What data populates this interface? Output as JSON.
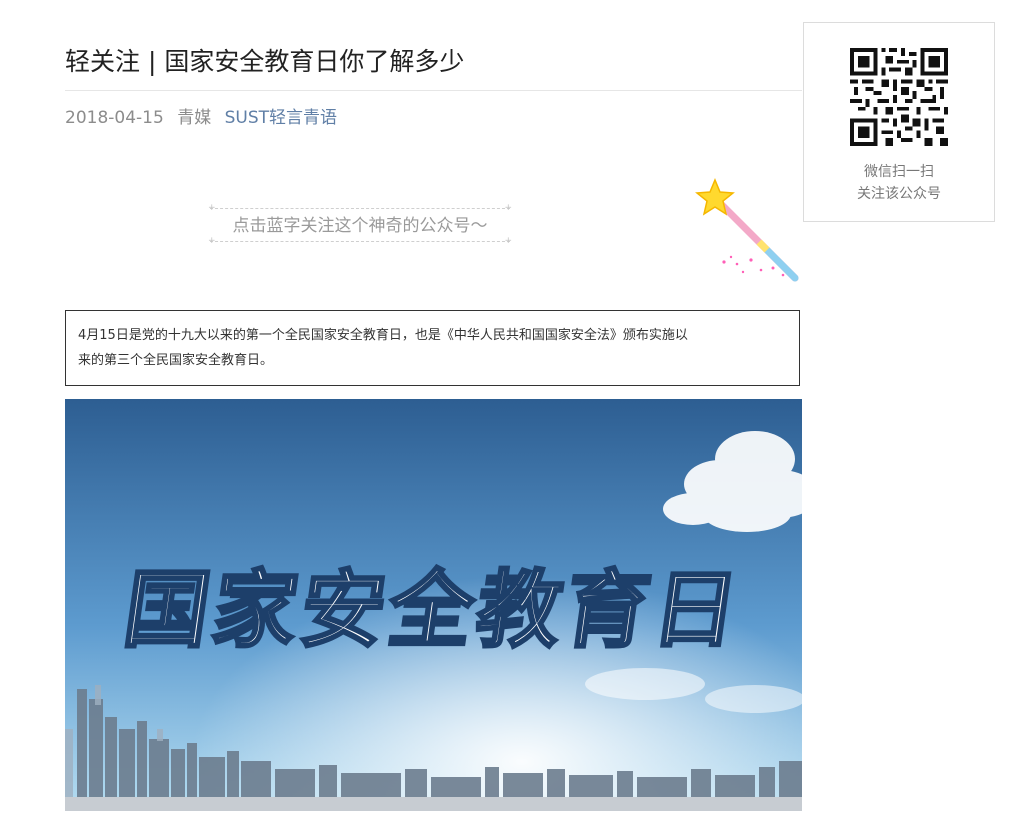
{
  "article": {
    "title": "轻关注 | 国家安全教育日你了解多少",
    "date": "2018-04-15",
    "author": "青媒",
    "account_name": "SUST轻言青语",
    "follow_hint": "点击蓝字关注这个神奇的公众号～",
    "intro_line1": "4月15日是党的十九大以来的第一个全民国家安全教育日，也是《中华人民共和国国家安全法》颁布实施以",
    "intro_line2": "来的第三个全民国家安全教育日。",
    "hero_text": "国家安全教育日"
  },
  "qr_panel": {
    "line1": "微信扫一扫",
    "line2": "关注该公众号"
  },
  "icons": {
    "wand": "magic-wand-star-icon",
    "qr": "qr-code"
  },
  "colors": {
    "account_link": "#607fa6",
    "sky_top": "#2f5f93",
    "sky_bottom": "#8fc7ea"
  }
}
